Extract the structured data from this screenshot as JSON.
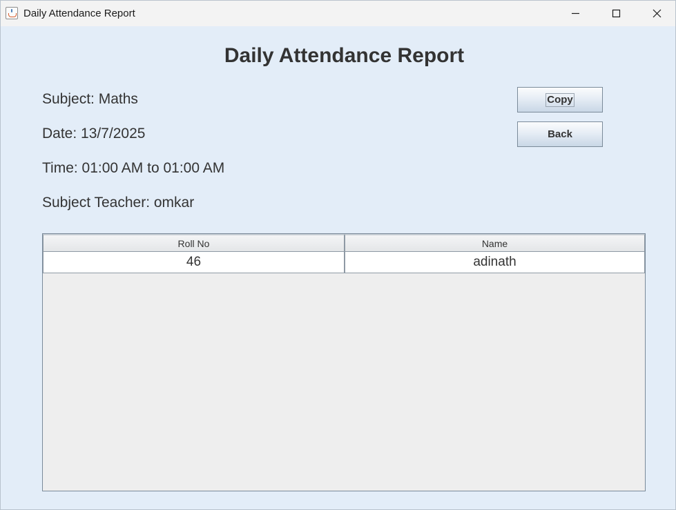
{
  "window": {
    "title": "Daily Attendance Report"
  },
  "report": {
    "heading": "Daily Attendance Report",
    "subject_line": "Subject: Maths",
    "date_line": "Date: 13/7/2025",
    "time_line": "Time: 01:00 AM to 01:00 AM",
    "teacher_line": "Subject Teacher: omkar"
  },
  "actions": {
    "copy_label": "Copy",
    "back_label": "Back"
  },
  "table": {
    "columns": [
      "Roll No",
      "Name"
    ],
    "rows": [
      [
        "46",
        "adinath"
      ]
    ]
  },
  "colors": {
    "window_background": "#e3edf8",
    "titlebar_background": "#f3f3f3",
    "table_background": "#eeeeee",
    "text": "#333333"
  },
  "icons": {
    "app": "java-cup-icon",
    "minimize": "minimize-icon",
    "maximize": "maximize-icon",
    "close": "close-icon"
  }
}
